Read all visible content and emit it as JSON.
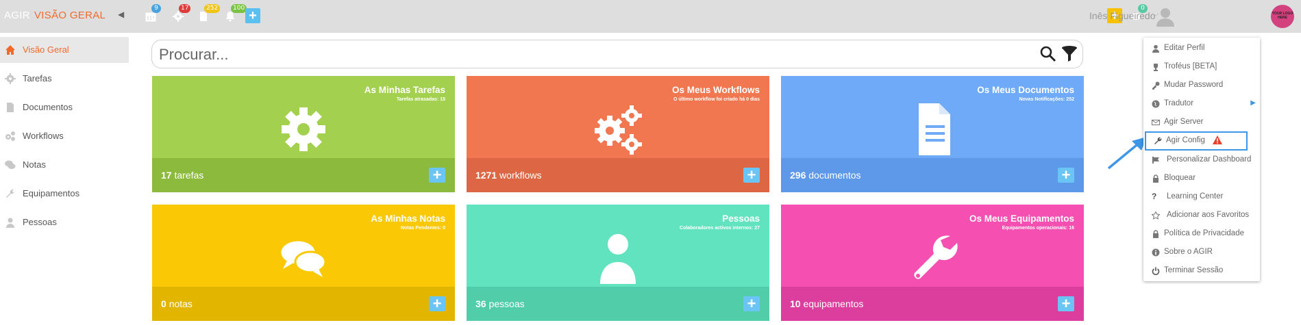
{
  "topbar": {
    "brand": "AGIR",
    "page_title": "VISÃO GERAL",
    "badges": [
      "9",
      "17",
      "252",
      "100"
    ],
    "notif_badge": "0",
    "user_name": "Inês Figueiredo",
    "logo_text": "YOUR LOGO HERE"
  },
  "sidebar": {
    "items": [
      {
        "label": "Visão Geral",
        "icon": "home-icon"
      },
      {
        "label": "Tarefas",
        "icon": "gear-icon"
      },
      {
        "label": "Documentos",
        "icon": "document-icon"
      },
      {
        "label": "Workflows",
        "icon": "gears-icon"
      },
      {
        "label": "Notas",
        "icon": "comments-icon"
      },
      {
        "label": "Equipamentos",
        "icon": "wrench-icon"
      },
      {
        "label": "Pessoas",
        "icon": "user-icon"
      }
    ]
  },
  "search": {
    "placeholder": "Procurar..."
  },
  "tiles": [
    {
      "title": "As Minhas Tarefas",
      "subtitle": "Tarefas atrasadas: 15",
      "count": "17",
      "unit": "tarefas",
      "color": "#a3d14f",
      "footer_color": "#8cba3c"
    },
    {
      "title": "Os Meus Workflows",
      "subtitle": "O último workflow foi criado há 0 dias",
      "count": "1271",
      "unit": "workflows",
      "color": "#f0774f",
      "footer_color": "#dd6744"
    },
    {
      "title": "Os Meus Documentos",
      "subtitle": "Novas Notificações: 252",
      "count": "296",
      "unit": "documentos",
      "color": "#6eaaf7",
      "footer_color": "#5d99e8"
    },
    {
      "title": "As Minhas Notas",
      "subtitle": "Notas Pendentes: 0",
      "count": "0",
      "unit": "notas",
      "color": "#fac804",
      "footer_color": "#e2b500"
    },
    {
      "title": "Pessoas",
      "subtitle": "Colaboradores activos internos: 27",
      "count": "36",
      "unit": "pessoas",
      "color": "#62e3bf",
      "footer_color": "#52cdaa"
    },
    {
      "title": "Os Meus Equipamentos",
      "subtitle": "Equipamentos operacionais: 16",
      "count": "10",
      "unit": "equipamentos",
      "color": "#f54fb2",
      "footer_color": "#db3e9c"
    }
  ],
  "dropdown": {
    "items": [
      {
        "label": "Editar Perfil",
        "icon": "user-icon"
      },
      {
        "label": "Troféus [BETA]",
        "icon": "trophy-icon"
      },
      {
        "label": "Mudar Password",
        "icon": "key-icon"
      },
      {
        "label": "Tradutor",
        "icon": "globe-icon"
      },
      {
        "label": "Agir Server",
        "icon": "envelope-icon"
      },
      {
        "label": "Agir Config",
        "icon": "wrench-icon"
      },
      {
        "label": "Personalizar Dashboard",
        "icon": "dashboard-icon"
      },
      {
        "label": "Bloquear",
        "icon": "lock-icon"
      },
      {
        "label": "Learning Center",
        "icon": "question-icon"
      },
      {
        "label": "Adicionar aos Favoritos",
        "icon": "star-icon"
      },
      {
        "label": "Política de Privacidade",
        "icon": "lock-icon"
      },
      {
        "label": "Sobre o AGIR",
        "icon": "info-icon"
      },
      {
        "label": "Terminar Sessão",
        "icon": "power-icon"
      }
    ]
  }
}
